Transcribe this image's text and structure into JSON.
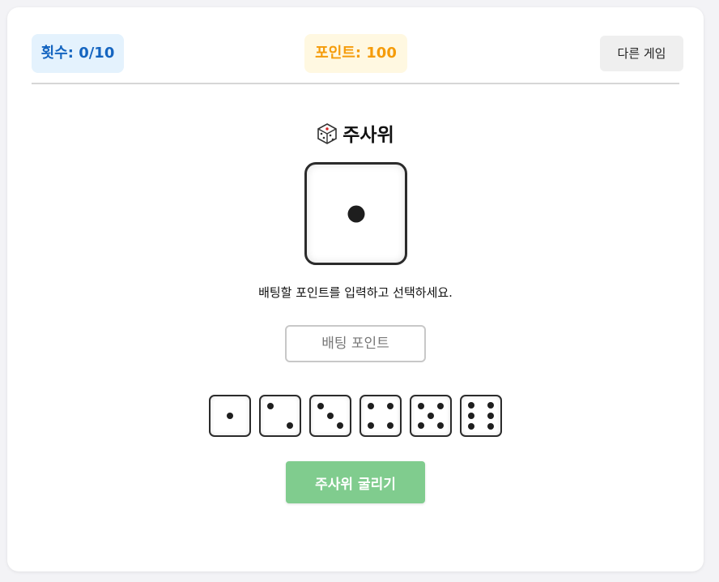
{
  "header": {
    "count_label": "횟수: 0/10",
    "points_label": "포인트: 100",
    "other_game_button": "다른 게임"
  },
  "game": {
    "title": "주사위",
    "title_icon": "dice-icon",
    "current_die_value": 1,
    "instruction": "배팅할 포인트를 입력하고 선택하세요.",
    "bet_input": {
      "placeholder": "배팅 포인트",
      "value": ""
    },
    "choices": [
      1,
      2,
      3,
      4,
      5,
      6
    ],
    "roll_button": "주사위 굴리기"
  },
  "colors": {
    "count_text": "#1565c0",
    "count_bg": "#e4f2fd",
    "points_text": "#f59c0a",
    "points_bg": "#fff8e1",
    "roll_button_bg": "#80cc8e"
  }
}
